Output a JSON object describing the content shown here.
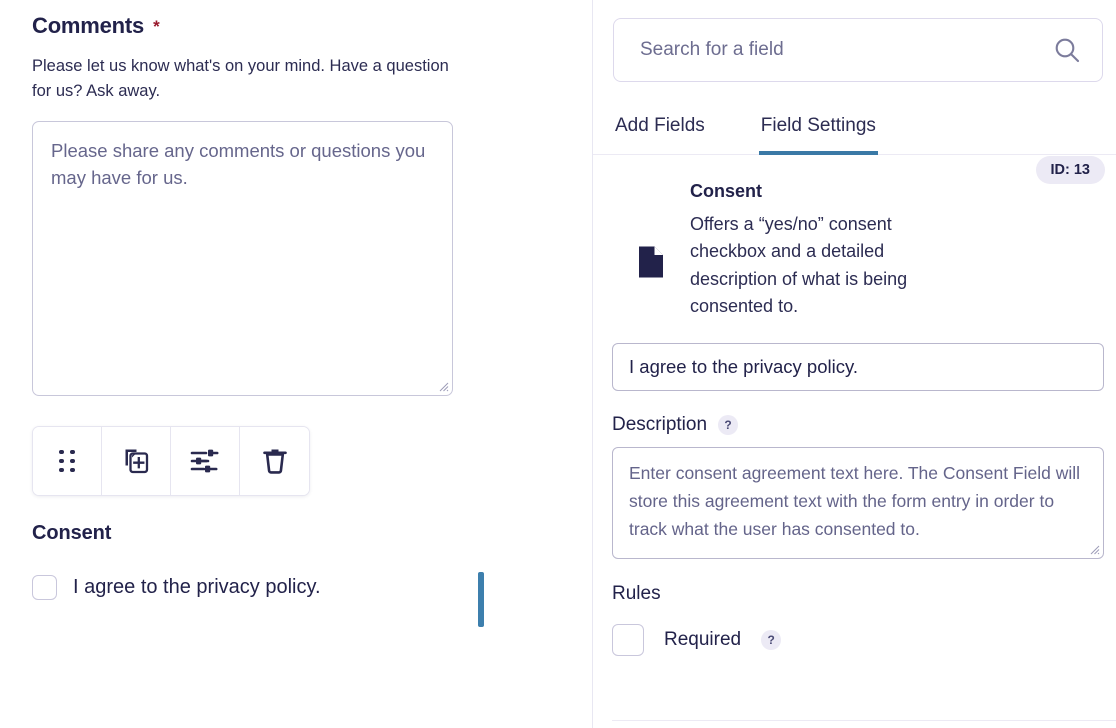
{
  "left_panel": {
    "field_title": "Comments",
    "required_marker": "*",
    "field_description": "Please let us know what's on your mind. Have a question for us? Ask away.",
    "textarea_placeholder": "Please share any comments or questions you may have for us.",
    "toolbar": {
      "drag_handle": "drag-handle-icon",
      "duplicate": "duplicate-icon",
      "settings": "sliders-icon",
      "delete": "trash-icon"
    },
    "consent_heading": "Consent",
    "consent_checkbox_label": "I agree to the privacy policy."
  },
  "right_panel": {
    "search": {
      "placeholder": "Search for a field",
      "value": "",
      "icon": "search-icon"
    },
    "tabs": [
      {
        "label": "Add Fields",
        "active": false
      },
      {
        "label": "Field Settings",
        "active": true
      }
    ],
    "field_info": {
      "icon": "document-icon",
      "title": "Consent",
      "description": "Offers a “yes/no” consent checkbox and a detailed description of what is being consented to.",
      "id_badge": "ID: 13"
    },
    "label_input": {
      "value": "I agree to the privacy policy.",
      "placeholder": ""
    },
    "description_section": {
      "label": "Description",
      "help_icon": "?",
      "textarea_placeholder": "Enter consent agreement text here.  The Consent Field will store this agreement text with the form entry in order to track what the user has consented to.",
      "textarea_value": ""
    },
    "rules_section": {
      "label": "Rules",
      "required_label": "Required",
      "required_checked": false,
      "help_icon": "?"
    }
  },
  "colors": {
    "accent_blue": "#3a79a6",
    "cursor_blue": "#3d7fad",
    "text_navy": "#22224a",
    "muted_text": "#66668c",
    "required_red": "#98182b",
    "badge_bg": "#eceaf5",
    "border_light": "#c8c7da"
  }
}
